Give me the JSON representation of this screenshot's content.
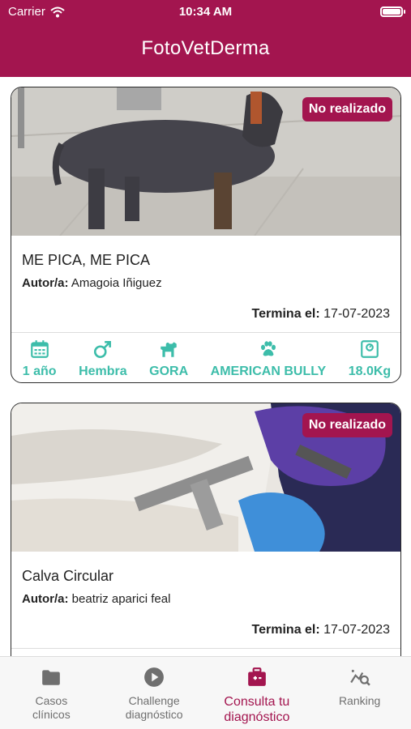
{
  "status_bar": {
    "carrier": "Carrier",
    "time": "10:34 AM"
  },
  "app": {
    "title": "FotoVetDerma"
  },
  "cases": [
    {
      "status": "No realizado",
      "title": "ME PICA, ME PICA",
      "author_label": "Autor/a:",
      "author": "Amagoia Iñiguez",
      "end_label": "Termina el:",
      "end_date": "17-07-2023",
      "stats": {
        "age": "1 año",
        "sex": "Hembra",
        "size": "GORA",
        "breed": "AMERICAN BULLY",
        "weight": "18.0Kg"
      }
    },
    {
      "status": "No realizado",
      "title": "Calva Circular",
      "author_label": "Autor/a:",
      "author": "beatriz aparici feal",
      "end_label": "Termina el:",
      "end_date": "17-07-2023"
    }
  ],
  "tabs": [
    {
      "label": "Casos\nclínicos",
      "icon": "folder-icon"
    },
    {
      "label": "Challenge\ndiagnóstico",
      "icon": "play-icon"
    },
    {
      "label": "Consulta tu\ndiagnóstico",
      "icon": "medical-kit-icon",
      "active": true
    },
    {
      "label": "Ranking",
      "icon": "chart-search-icon"
    }
  ],
  "colors": {
    "brand": "#a3154f",
    "accent": "#3dbdaa"
  }
}
